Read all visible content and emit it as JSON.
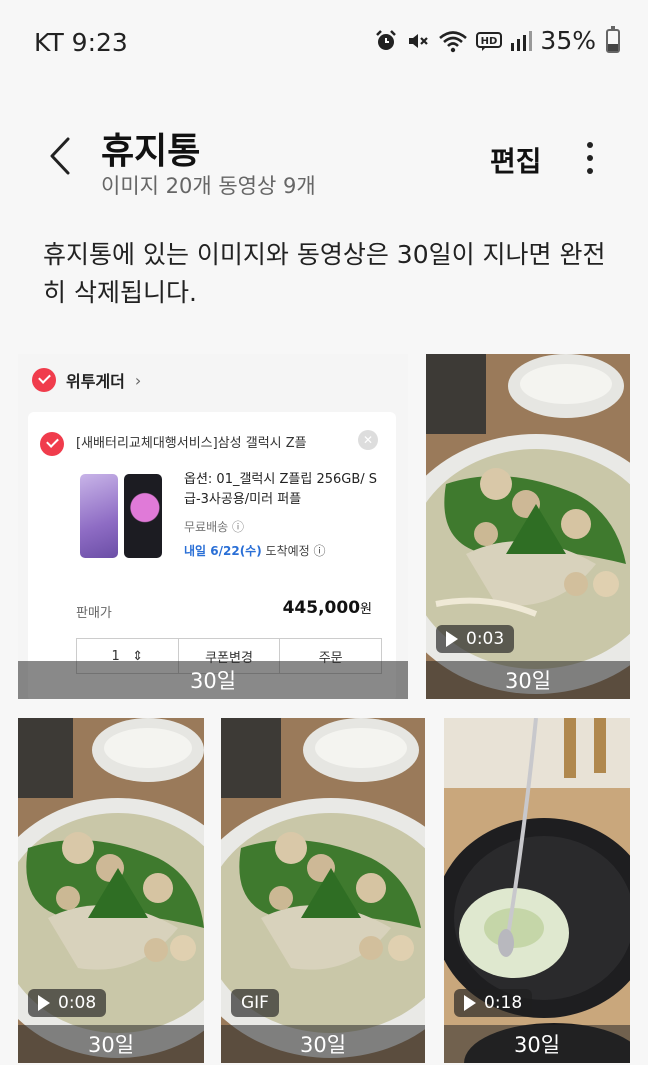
{
  "status_bar": {
    "carrier_time": "KT 9:23",
    "battery": "35%",
    "battery_level": 0.35,
    "icons": [
      "alarm-icon",
      "mute-icon",
      "wifi-icon",
      "hd-voice-icon",
      "signal-icon",
      "battery-icon"
    ]
  },
  "header": {
    "title": "휴지통",
    "subtitle": "이미지 20개 동영상 9개",
    "edit_label": "편집"
  },
  "notice": "휴지통에 있는 이미지와 동영상은 30일이 지나면 완전히 삭제됩니다.",
  "screenshot": {
    "seller": "위투게더",
    "product_title": "[새배터리교체대행서비스]삼성 갤럭시 Z플",
    "option": "옵션: 01_갤럭시 Z플립 256GB/ S급-3사공용/미러 퍼플",
    "shipping": "무료배송",
    "delivery_date": "내일 6/22(수)",
    "delivery_suffix": "도착예정",
    "price_label": "판매가",
    "price": "445,000",
    "price_unit": "원",
    "qty": "1",
    "coupon": "쿠폰변경",
    "order": "주문"
  },
  "items": [
    {
      "type": "image",
      "days": "30일"
    },
    {
      "type": "video",
      "duration": "0:03",
      "days": "30일"
    },
    {
      "type": "video",
      "duration": "0:08",
      "days": "30일"
    },
    {
      "type": "gif",
      "badge": "GIF",
      "days": "30일"
    },
    {
      "type": "video",
      "duration": "0:18",
      "days": "30일"
    }
  ],
  "colors": {
    "background": "#f7f7f7",
    "accent_red": "#f03c4c",
    "link_blue": "#2a6fd6"
  }
}
